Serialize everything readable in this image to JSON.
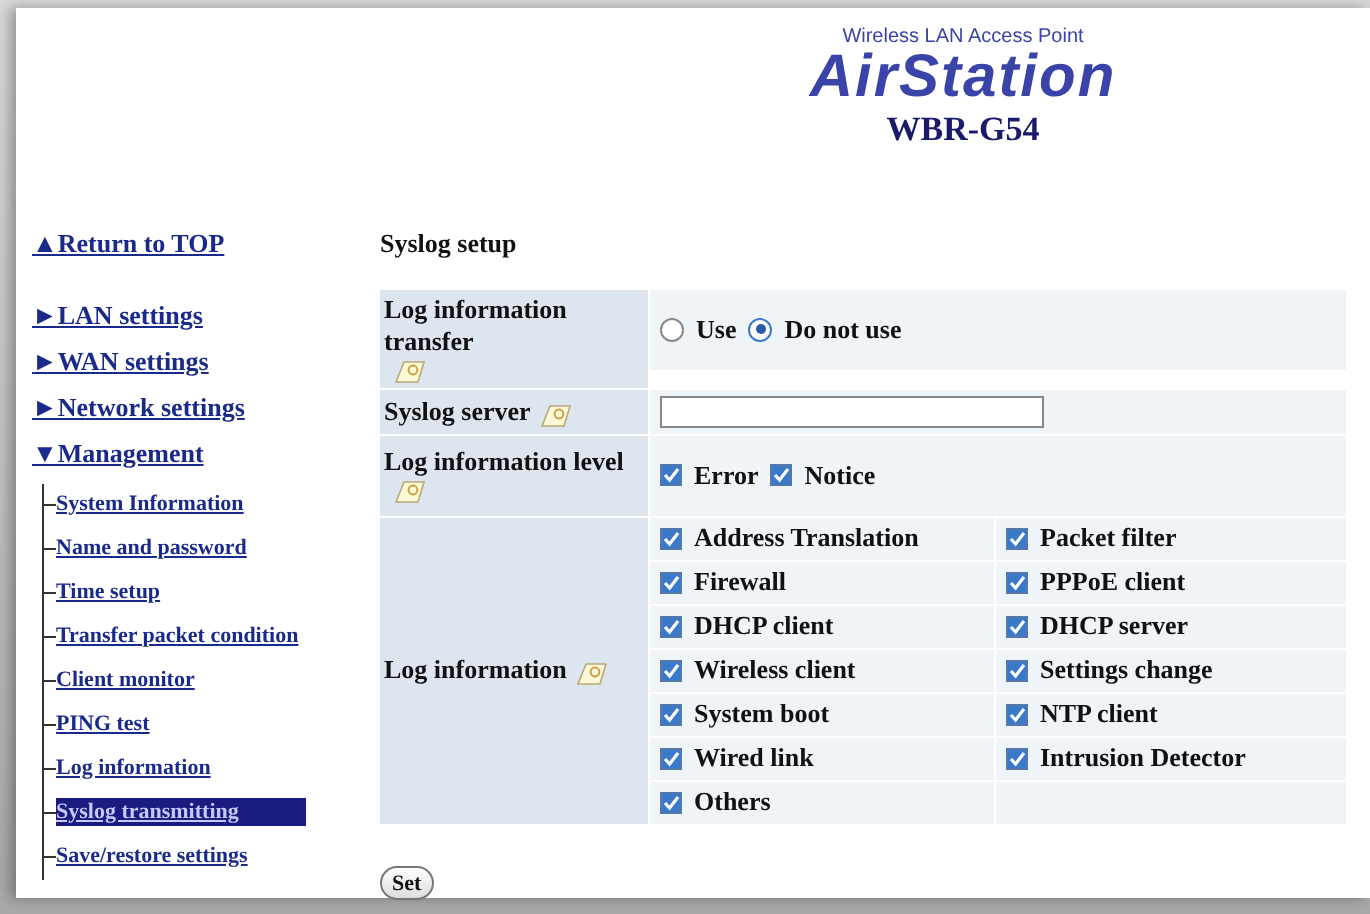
{
  "logo": {
    "tagline": "Wireless LAN Access Point",
    "brand": "AirStation",
    "model": "WBR-G54"
  },
  "sidebar": {
    "return_link": {
      "marker": "▲",
      "label": "Return to TOP"
    },
    "sections": [
      {
        "marker": "►",
        "label": "LAN settings"
      },
      {
        "marker": "►",
        "label": "WAN settings"
      },
      {
        "marker": "►",
        "label": "Network settings"
      },
      {
        "marker": "▼",
        "label": "Management",
        "children": [
          {
            "label": "System Information",
            "selected": false
          },
          {
            "label": "Name and password",
            "selected": false
          },
          {
            "label": "Time setup",
            "selected": false
          },
          {
            "label": "Transfer packet condition",
            "selected": false
          },
          {
            "label": "Client monitor",
            "selected": false
          },
          {
            "label": "PING test",
            "selected": false
          },
          {
            "label": "Log information",
            "selected": false
          },
          {
            "label": "Syslog transmitting",
            "selected": true
          },
          {
            "label": "Save/restore settings",
            "selected": false
          }
        ]
      }
    ]
  },
  "form": {
    "title": "Syslog setup",
    "rows": [
      {
        "kind": "radio",
        "label": "Log information transfer",
        "options": [
          {
            "label": "Use",
            "selected": false
          },
          {
            "label": "Do not use",
            "selected": true
          }
        ]
      },
      {
        "kind": "text",
        "label": "Syslog server"
      },
      {
        "kind": "checks",
        "label": "Log information level",
        "options": [
          {
            "label": "Error",
            "checked": true
          },
          {
            "label": "Notice",
            "checked": true
          }
        ]
      },
      {
        "kind": "grid",
        "label": "Log information",
        "options": [
          {
            "label": "Address Translation",
            "checked": true
          },
          {
            "label": "Packet filter",
            "checked": true
          },
          {
            "label": "Firewall",
            "checked": true
          },
          {
            "label": "PPPoE client",
            "checked": true
          },
          {
            "label": "DHCP client",
            "checked": true
          },
          {
            "label": "DHCP server",
            "checked": true
          },
          {
            "label": "Wireless client",
            "checked": true
          },
          {
            "label": "Settings change",
            "checked": true
          },
          {
            "label": "System boot",
            "checked": true
          },
          {
            "label": "NTP client",
            "checked": true
          },
          {
            "label": "Wired link",
            "checked": true
          },
          {
            "label": "Intrusion Detector",
            "checked": true
          },
          {
            "label": "Others",
            "checked": true
          }
        ]
      }
    ],
    "button": "Set"
  }
}
